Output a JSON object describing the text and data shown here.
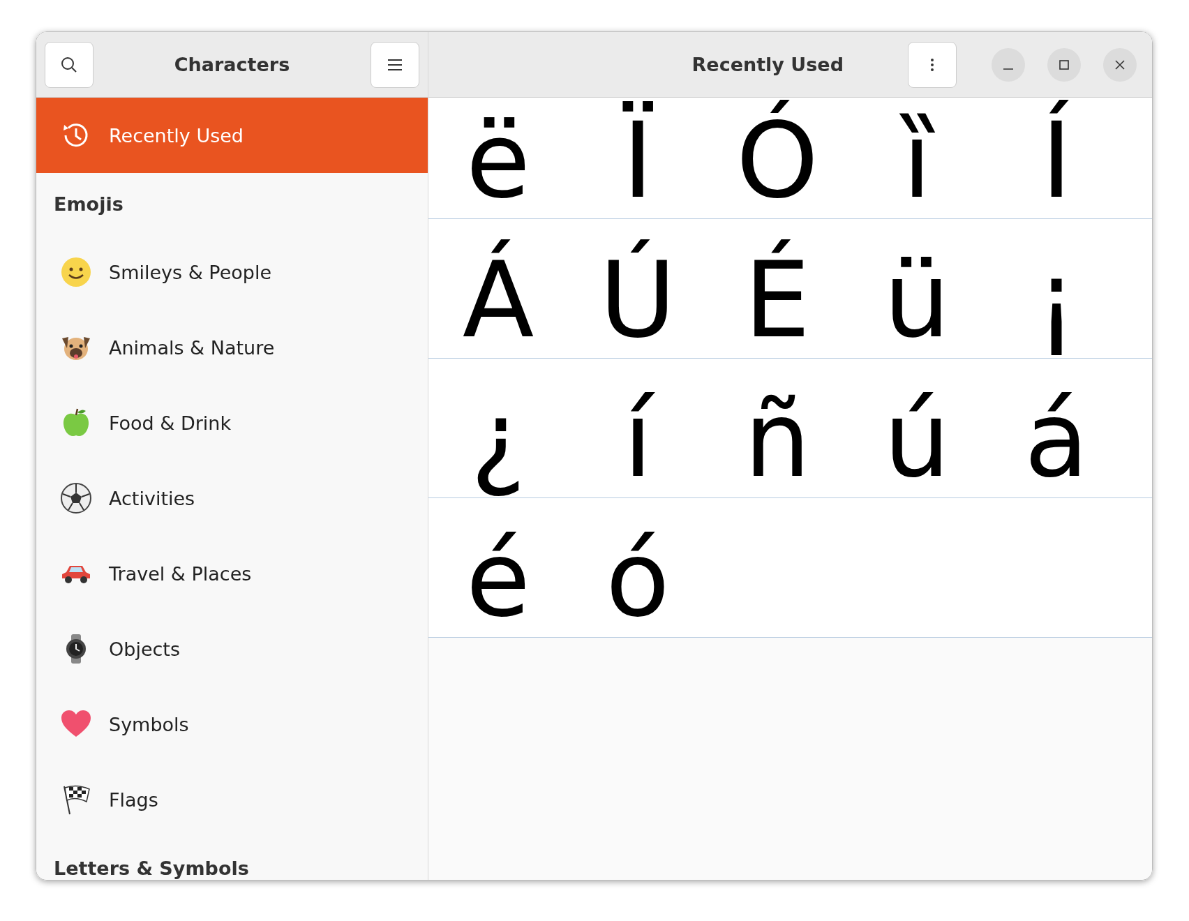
{
  "sidebar": {
    "title": "Characters",
    "items": [
      {
        "kind": "item",
        "label": "Recently Used",
        "selected": true
      },
      {
        "kind": "heading",
        "label": "Emojis"
      },
      {
        "kind": "item",
        "label": "Smileys & People",
        "selected": false
      },
      {
        "kind": "item",
        "label": "Animals & Nature",
        "selected": false
      },
      {
        "kind": "item",
        "label": "Food & Drink",
        "selected": false
      },
      {
        "kind": "item",
        "label": "Activities",
        "selected": false
      },
      {
        "kind": "item",
        "label": "Travel & Places",
        "selected": false
      },
      {
        "kind": "item",
        "label": "Objects",
        "selected": false
      },
      {
        "kind": "item",
        "label": "Symbols",
        "selected": false
      },
      {
        "kind": "item",
        "label": "Flags",
        "selected": false
      },
      {
        "kind": "heading",
        "label": "Letters & Symbols"
      }
    ]
  },
  "content": {
    "title": "Recently Used",
    "characters": [
      "ë",
      "Ï",
      "Ó",
      "ȉ",
      "Í",
      "Á",
      "Ú",
      "É",
      "ü",
      "¡",
      "¿",
      "í",
      "ñ",
      "ú",
      "á",
      "é",
      "ó"
    ]
  }
}
